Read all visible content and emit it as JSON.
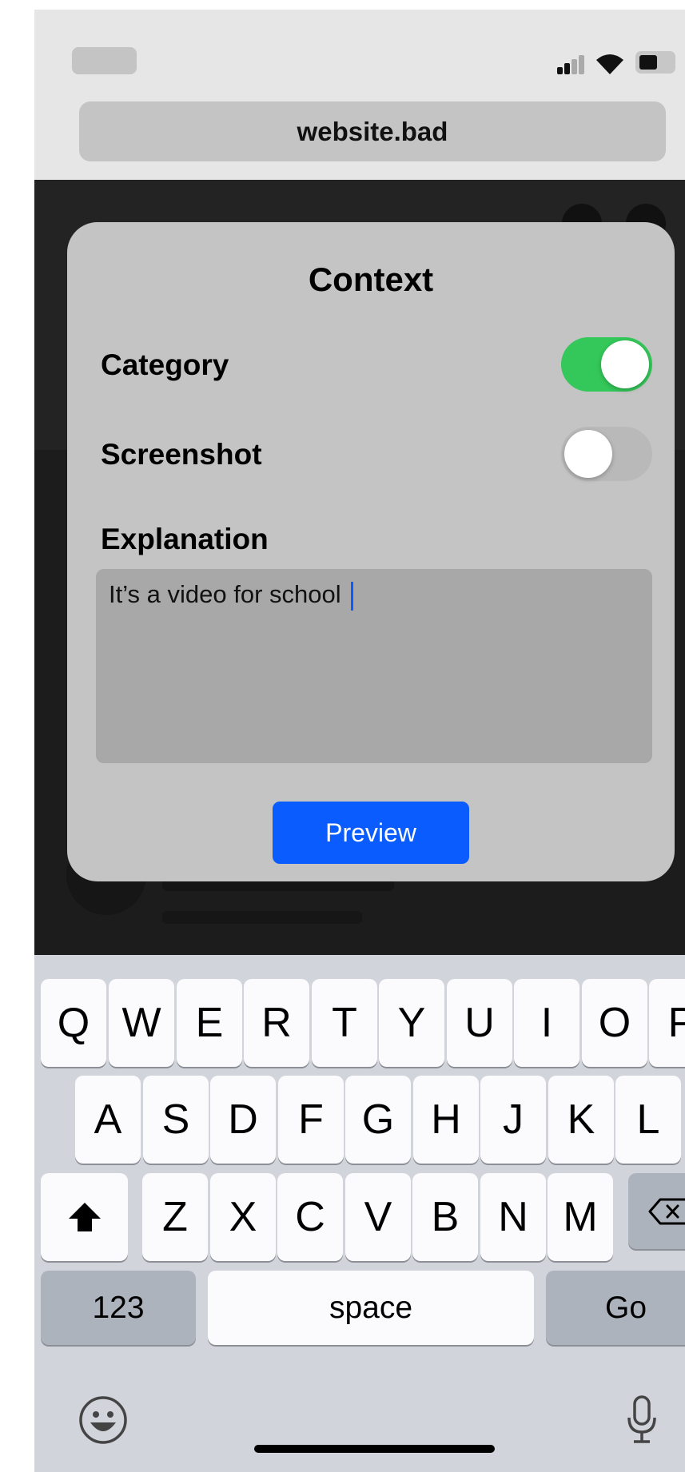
{
  "browser": {
    "url": "website.bad"
  },
  "modal": {
    "title": "Context",
    "category_label": "Category",
    "category_enabled": true,
    "screenshot_label": "Screenshot",
    "screenshot_enabled": false,
    "explanation_label": "Explanation",
    "explanation_value": "It’s a video for school",
    "preview_label": "Preview"
  },
  "keyboard": {
    "row1": [
      "Q",
      "W",
      "E",
      "R",
      "T",
      "Y",
      "U",
      "I",
      "O",
      "P"
    ],
    "row2": [
      "A",
      "S",
      "D",
      "F",
      "G",
      "H",
      "J",
      "K",
      "L"
    ],
    "row3": [
      "Z",
      "X",
      "C",
      "V",
      "B",
      "N",
      "M"
    ],
    "numbers_label": "123",
    "space_label": "space",
    "go_label": "Go"
  },
  "colors": {
    "toggle_on": "#34c759",
    "accent": "#0a5cff",
    "caret": "#0a5cff"
  },
  "icons": [
    "signal-icon",
    "wifi-icon",
    "battery-icon",
    "shift-icon",
    "backspace-icon",
    "emoji-icon",
    "microphone-icon"
  ]
}
